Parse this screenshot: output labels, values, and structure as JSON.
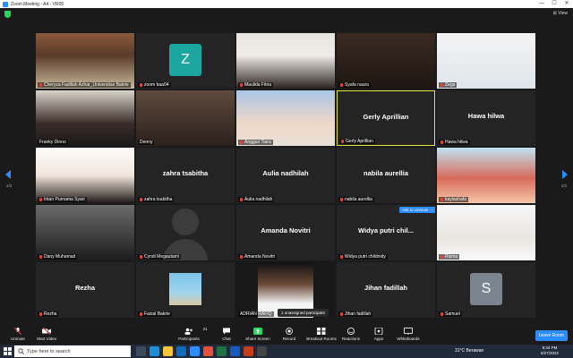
{
  "window": {
    "title": "Zoom Meeting - A4 - VR05",
    "controls": [
      "—",
      "☐",
      "✕"
    ]
  },
  "view_button": "⊞ View",
  "pagination": {
    "left": "1/2",
    "right": "1/2"
  },
  "tiles": [
    {
      "name": "Cheryza Fadillah Azhar_Universitas Bakrie",
      "type": "video",
      "muted": true,
      "scene": "shelf"
    },
    {
      "name": "zoom baa04",
      "type": "avatar",
      "avatar_letter": "Z",
      "avatar_color": "#1ba6a0",
      "muted": true
    },
    {
      "name": "Maulida Fitria",
      "type": "video",
      "muted": true,
      "scene": "hijab"
    },
    {
      "name": "Syafa naura",
      "type": "video",
      "muted": true,
      "scene": "dark"
    },
    {
      "name": "Zega",
      "type": "video",
      "muted": true,
      "scene": "wall"
    },
    {
      "name": "Franky Dinno",
      "type": "video",
      "muted": false,
      "scene": "man"
    },
    {
      "name": "Denny",
      "type": "video",
      "muted": false,
      "scene": "room"
    },
    {
      "name": "Anggun Tiara",
      "type": "video",
      "muted": true,
      "scene": "woman"
    },
    {
      "name": "Gerly Aprillian",
      "type": "name",
      "muted": true,
      "active": true
    },
    {
      "name": "Hawa hilwa",
      "type": "name",
      "muted": true
    },
    {
      "name": "Intan Purnama Syari",
      "type": "video",
      "muted": true,
      "scene": "portrait"
    },
    {
      "name": "zahra tsabitha",
      "type": "name",
      "muted": true
    },
    {
      "name": "Aulia nadhilah",
      "type": "name",
      "muted": true
    },
    {
      "name": "nabila aurellia",
      "type": "name",
      "muted": true
    },
    {
      "name": "kaylashafa",
      "type": "video",
      "muted": true,
      "scene": "cartoon"
    },
    {
      "name": "Dany Muhamad",
      "type": "video",
      "muted": true,
      "scene": "shirt"
    },
    {
      "name": "Cyndi Megautami",
      "type": "avatar-dark",
      "muted": true
    },
    {
      "name": "Amanda Novitri",
      "type": "name",
      "muted": true
    },
    {
      "name": "Widya putri chil...",
      "label": "Widya putri childnidy",
      "type": "name",
      "muted": true,
      "ask_unmute": "Ask to Unmute",
      "more": "···"
    },
    {
      "name": "Risma",
      "type": "video",
      "muted": true,
      "scene": "hijab2"
    },
    {
      "name": "Rezha",
      "type": "name",
      "muted": true
    },
    {
      "name": "Faisal Bakrie",
      "type": "video",
      "muted": true,
      "scene": "beach"
    },
    {
      "name": "ADRIAN RAFIQ",
      "type": "video",
      "muted": false,
      "scene": "man2"
    },
    {
      "name": "Jihan fadillah",
      "type": "name",
      "muted": true
    },
    {
      "name": "Samuel",
      "type": "avatar",
      "avatar_letter": "S",
      "avatar_color": "#7a8590",
      "muted": true
    }
  ],
  "popup": "1 unassigned participant",
  "toolbar": {
    "unmute": "Unmute",
    "start_video": "Start Video",
    "participants": "Participants",
    "participants_count": "31",
    "chat": "Chat",
    "share_screen": "Share Screen",
    "record": "Record",
    "breakout_rooms": "Breakout Rooms",
    "reactions": "Reactions",
    "apps": "Apps",
    "whiteboards": "Whiteboards",
    "leave": "Leave Room"
  },
  "taskbar": {
    "search_placeholder": "Type here to search",
    "weather": "31°C Berawan",
    "time": "9:34 PM",
    "date": "6/27/2022"
  },
  "colors": {
    "accent": "#2d8cff",
    "active_border": "#e5e542",
    "muted_mic": "#e34141",
    "share_green": "#23d959"
  }
}
